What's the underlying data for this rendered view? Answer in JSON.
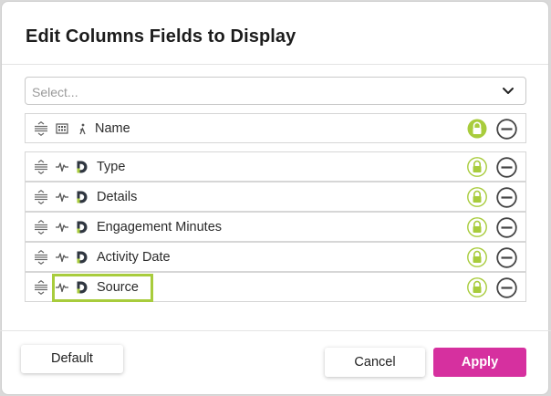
{
  "dialog": {
    "title": "Edit Columns Fields to Display"
  },
  "select": {
    "placeholder": "Select..."
  },
  "colors": {
    "accent_green": "#a8cc3c",
    "apply_pink": "#d6309f",
    "icon_gray": "#555555"
  },
  "pinned_row": {
    "label": "Name",
    "type_icon": "building-icon",
    "source_icon": "person-icon",
    "locked": true
  },
  "rows": [
    {
      "label": "Type",
      "type_icon": "activity-pulse-icon",
      "source_icon": "d-logo-icon",
      "locked": false
    },
    {
      "label": "Details",
      "type_icon": "activity-pulse-icon",
      "source_icon": "d-logo-icon",
      "locked": false
    },
    {
      "label": "Engagement Minutes",
      "type_icon": "activity-pulse-icon",
      "source_icon": "d-logo-icon",
      "locked": false
    },
    {
      "label": "Activity Date",
      "type_icon": "activity-pulse-icon",
      "source_icon": "d-logo-icon",
      "locked": false
    },
    {
      "label": "Source",
      "type_icon": "activity-pulse-icon",
      "source_icon": "d-logo-icon",
      "locked": false
    }
  ],
  "footer": {
    "default_label": "Default",
    "cancel_label": "Cancel",
    "apply_label": "Apply"
  }
}
